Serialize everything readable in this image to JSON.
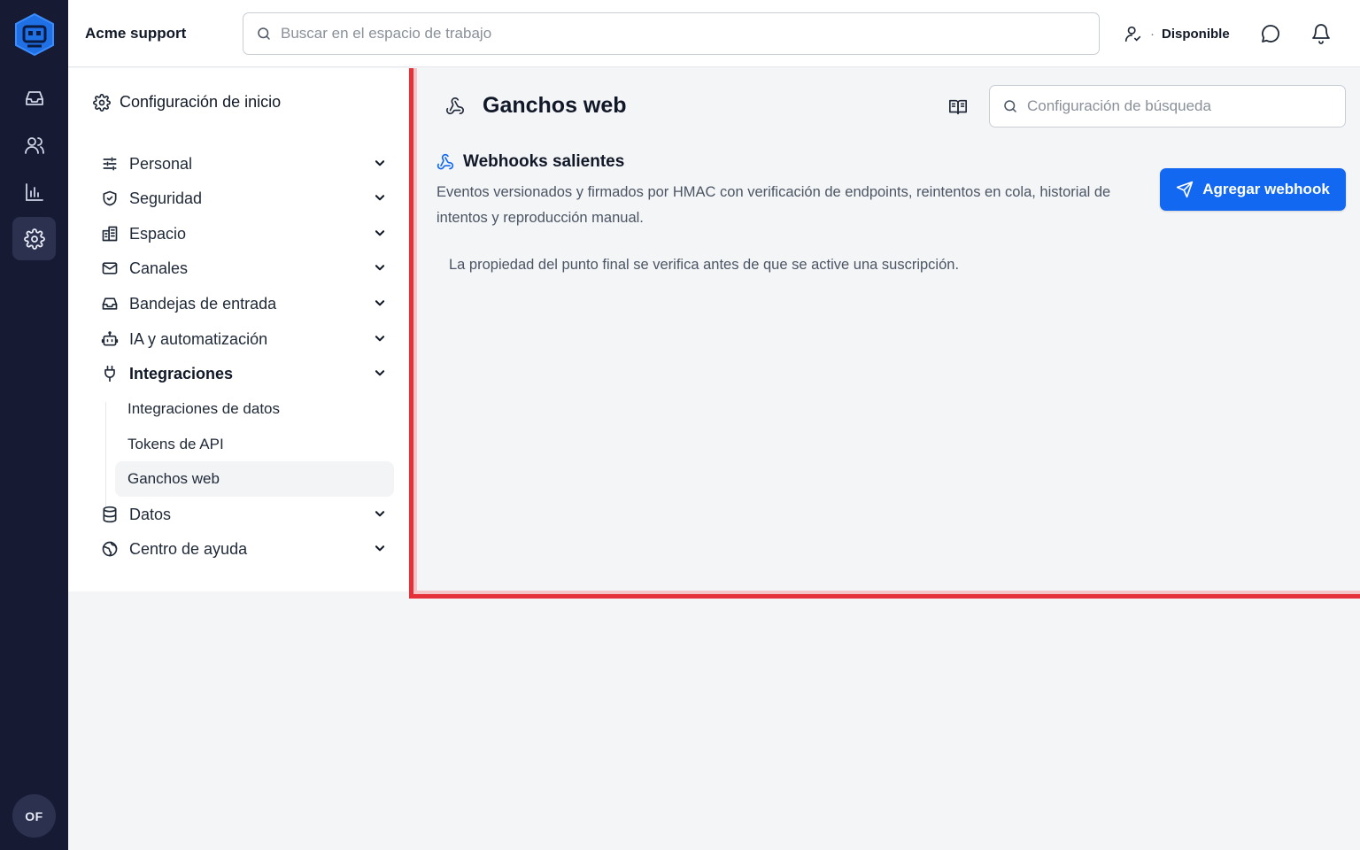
{
  "app": {
    "workspace_name": "Acme support",
    "search_placeholder": "Buscar en el espacio de trabajo",
    "user_status": "Disponible",
    "user_initials": "OF"
  },
  "rail": {
    "items": [
      {
        "icon": "inbox-icon"
      },
      {
        "icon": "contacts-icon"
      },
      {
        "icon": "reports-icon"
      },
      {
        "icon": "settings-icon",
        "active": true
      }
    ]
  },
  "settings_nav": {
    "header": "Configuración de inicio",
    "items": [
      {
        "label": "Personal",
        "icon": "sliders-icon"
      },
      {
        "label": "Seguridad",
        "icon": "shield-icon"
      },
      {
        "label": "Espacio",
        "icon": "building-icon"
      },
      {
        "label": "Canales",
        "icon": "mail-icon"
      },
      {
        "label": "Bandejas de entrada",
        "icon": "inbox-icon"
      },
      {
        "label": "IA y automatización",
        "icon": "bot-icon"
      },
      {
        "label": "Integraciones",
        "icon": "plug-icon",
        "expanded": true
      },
      {
        "label": "Datos",
        "icon": "database-icon"
      },
      {
        "label": "Centro de ayuda",
        "icon": "globe-icon"
      }
    ],
    "sub_items": [
      {
        "label": "Integraciones de datos"
      },
      {
        "label": "Tokens de API"
      },
      {
        "label": "Ganchos web",
        "active": true
      }
    ]
  },
  "page": {
    "title": "Ganchos web",
    "settings_search_placeholder": "Configuración de búsqueda",
    "section": {
      "title": "Webhooks salientes",
      "description": "Eventos versionados y firmados por HMAC con verificación de endpoints, reintentos en cola, historial de intentos y reproducción manual.",
      "add_button_label": "Agregar webhook"
    },
    "note": "La propiedad del punto final se verifica antes de que se active una suscripción."
  },
  "colors": {
    "rail_background": "#161a33",
    "primary": "#1268f0",
    "highlight_border": "#e5313a"
  }
}
